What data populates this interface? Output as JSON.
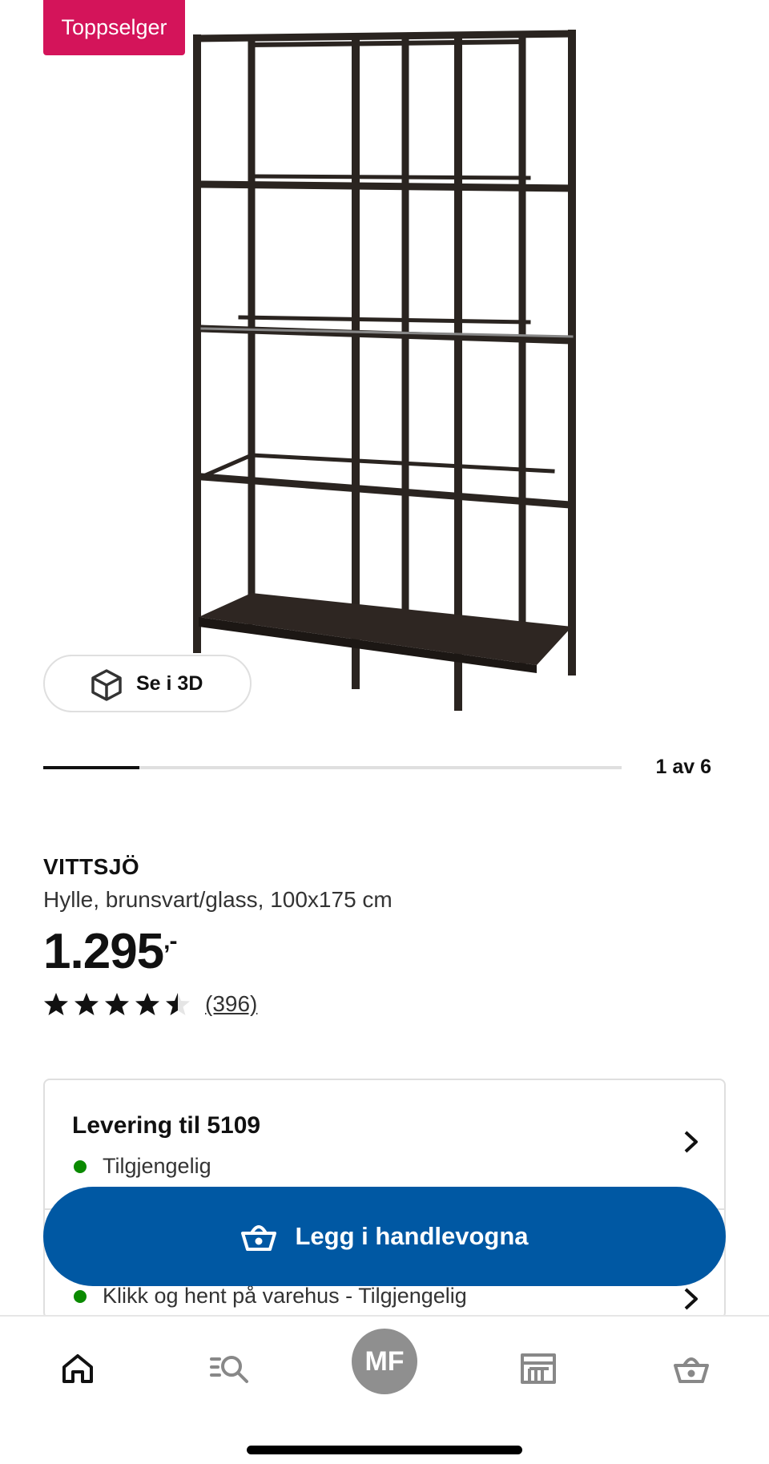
{
  "badge": {
    "label": "Toppselger"
  },
  "gallery": {
    "view_3d_label": "Se i 3D",
    "current": 1,
    "total": 6,
    "pager_label": "1 av 6"
  },
  "product": {
    "name": "VITTSJÖ",
    "description": "Hylle, brunsvart/glass, 100x175 cm",
    "price_main": "1.295",
    "price_suffix": ",-",
    "rating_value": 4.5,
    "rating_max": 5,
    "rating_count": "(396)"
  },
  "availability": {
    "delivery_title": "Levering til 5109",
    "delivery_status": "Tilgjengelig",
    "pickup_status": "Klikk og hent på varehus - Tilgjengelig",
    "status_color": "#0a8a00"
  },
  "cta": {
    "label": "Legg i handlevogna",
    "color": "#0058a3"
  },
  "tabbar": {
    "items": [
      {
        "name": "home",
        "icon": "home-icon"
      },
      {
        "name": "search",
        "icon": "search-icon"
      },
      {
        "name": "profile",
        "icon": "avatar",
        "initials": "MF"
      },
      {
        "name": "stores",
        "icon": "store-icon"
      },
      {
        "name": "cart",
        "icon": "cart-icon"
      }
    ]
  },
  "colors": {
    "badge": "#d4145a",
    "accent": "#0058a3"
  }
}
